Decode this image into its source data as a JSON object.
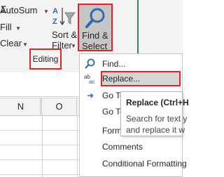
{
  "ribbon": {
    "autosum_label": "AutoSum",
    "fill_label": "Fill",
    "clear_label": "Clear",
    "sort_filter_line1": "Sort &",
    "sort_filter_line2": "Filter",
    "find_select_line1": "Find &",
    "find_select_line2": "Select",
    "group_label": "Editing"
  },
  "columns": [
    "N",
    "O"
  ],
  "menu": {
    "items": [
      {
        "label": "Find...",
        "icon": "find-icon"
      },
      {
        "label": "Replace...",
        "icon": "replace-icon"
      },
      {
        "label": "Go To",
        "icon": "go-to-arrow-icon"
      },
      {
        "label": "Go To",
        "icon": ""
      },
      {
        "label": "Formu",
        "icon": ""
      },
      {
        "label": "Comments",
        "icon": ""
      },
      {
        "label": "Conditional Formatting",
        "icon": ""
      }
    ]
  },
  "tooltip": {
    "title": "Replace (Ctrl+H",
    "line1": "Search for text y",
    "line2": "and replace it w"
  },
  "colors": {
    "highlight_red": "#e8202a",
    "excel_green": "#2e8b57",
    "icon_blue": "#2b6cb0"
  }
}
